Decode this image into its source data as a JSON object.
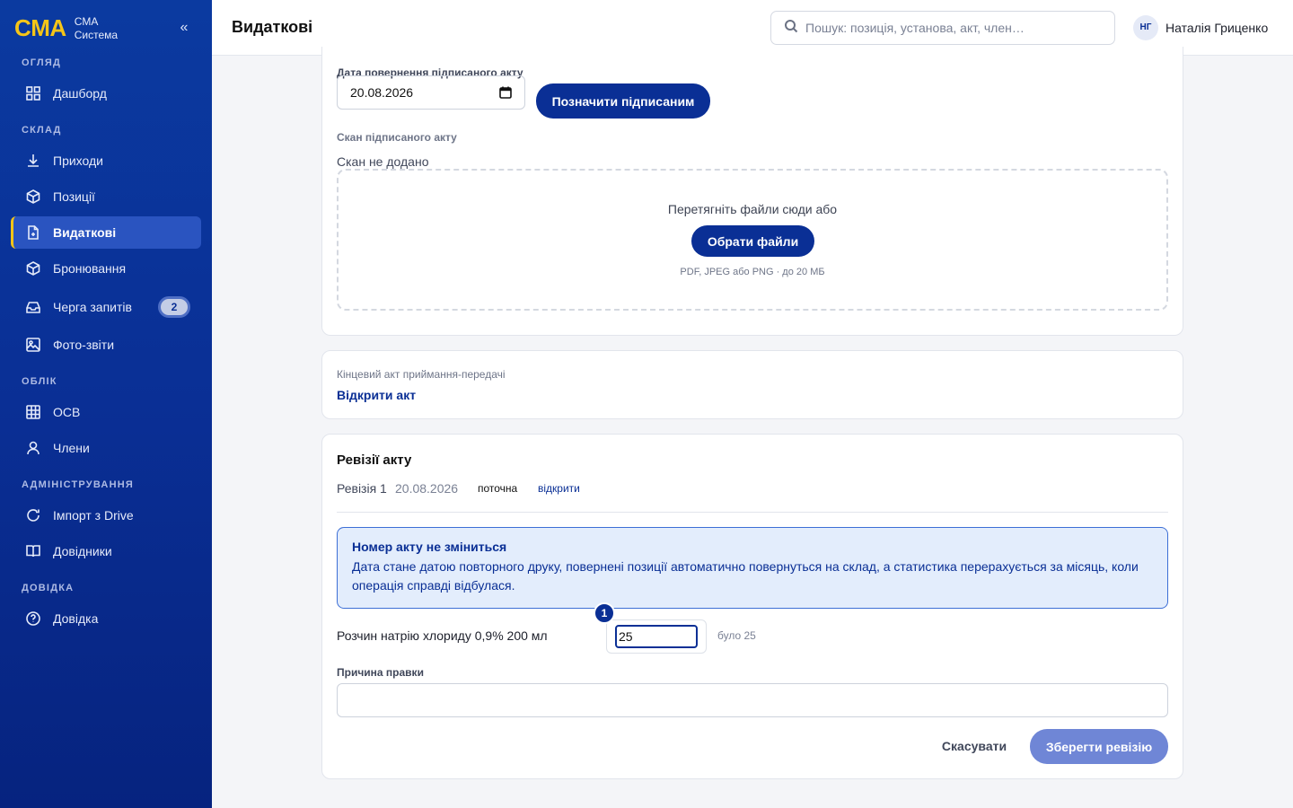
{
  "brand": {
    "logo": "CMA",
    "line1": "CMA",
    "line2": "Система",
    "collapse": "«"
  },
  "sidebar": {
    "sections": [
      {
        "label": "ОГЛЯД"
      },
      {
        "label": "СКЛАД"
      },
      {
        "label": "ОБЛІК"
      },
      {
        "label": "АДМІНІСТРУВАННЯ"
      },
      {
        "label": "ДОВІДКА"
      }
    ],
    "items": [
      {
        "label": "Дашборд",
        "icon": "grid-icon"
      },
      {
        "label": "Приходи",
        "icon": "download-icon"
      },
      {
        "label": "Позиції",
        "icon": "box-icon"
      },
      {
        "label": "Видаткові",
        "icon": "document-icon",
        "active": true
      },
      {
        "label": "Бронювання",
        "icon": "box-icon"
      },
      {
        "label": "Черга запитів",
        "icon": "inbox-icon",
        "badge": "2"
      },
      {
        "label": "Фото-звіти",
        "icon": "image-icon"
      },
      {
        "label": "ОСВ",
        "icon": "table-icon"
      },
      {
        "label": "Члени",
        "icon": "user-icon"
      },
      {
        "label": "Імпорт з Drive",
        "icon": "refresh-icon"
      },
      {
        "label": "Довідники",
        "icon": "book-icon"
      },
      {
        "label": "Довідка",
        "icon": "help-icon"
      }
    ]
  },
  "header": {
    "title": "Видаткові",
    "search_placeholder": "Пошук: позиція, установа, акт, член…",
    "user_initials": "НГ",
    "user_name": "Наталія Гриценко"
  },
  "signed": {
    "date_label": "Дата повернення підписаного акту",
    "date_value": "20.08.2026",
    "mark_button": "Позначити підписаним",
    "scan_label": "Скан підписаного акту",
    "scan_status": "Скан не додано",
    "dropzone_text": "Перетягніть файли сюди або",
    "choose_button": "Обрати файли",
    "dropzone_hint": "PDF, JPEG або PNG · до 20 МБ"
  },
  "final_act": {
    "label": "Кінцевий акт приймання-передачі",
    "link": "Відкрити акт"
  },
  "revisions": {
    "title": "Ревізії акту",
    "rows": [
      {
        "name": "Ревізія 1",
        "date": "20.08.2026",
        "status": "поточна",
        "action": "відкрити"
      }
    ],
    "info_title": "Номер акту не зміниться",
    "info_body": "Дата стане датою повторного друку, повернені позиції автоматично повернуться на склад, а статистика перерахується за місяць, коли операція справді відбулася.",
    "item_name": "Розчин натрію хлориду 0,9% 200 мл",
    "step": "1",
    "qty_value": "25",
    "was_text": "було 25",
    "reason_label": "Причина правки",
    "reason_value": "",
    "cancel_button": "Скасувати",
    "save_button": "Зберегти ревізію"
  }
}
